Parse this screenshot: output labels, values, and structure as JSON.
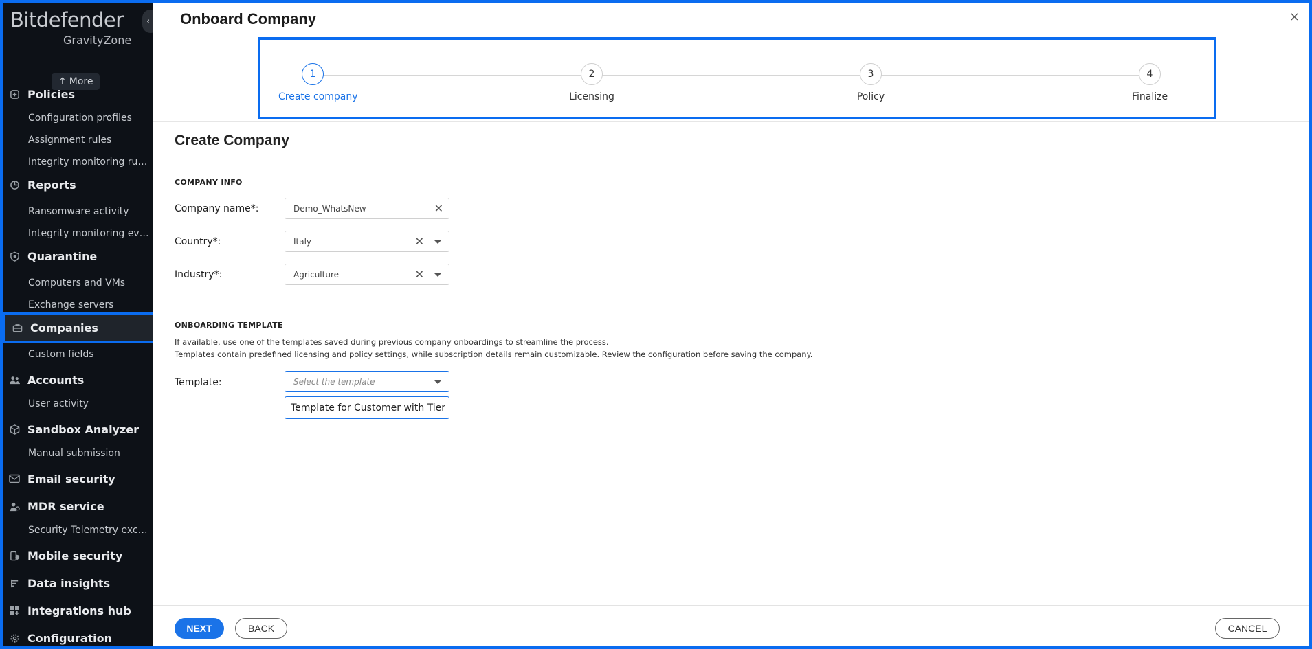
{
  "brand": {
    "name": "Bitdefender",
    "product": "GravityZone"
  },
  "sidebar": {
    "more_label": "More",
    "sections": [
      {
        "label": "Policies",
        "icon": "shield-icon",
        "subs": [
          "Configuration profiles",
          "Assignment rules",
          "Integrity monitoring rules"
        ]
      },
      {
        "label": "Reports",
        "icon": "chart-icon",
        "subs": [
          "Ransomware activity",
          "Integrity monitoring eve..."
        ]
      },
      {
        "label": "Quarantine",
        "icon": "quarantine-icon",
        "subs": [
          "Computers and VMs",
          "Exchange servers"
        ]
      },
      {
        "label": "Companies",
        "icon": "briefcase-icon",
        "subs": [
          "Custom fields"
        ]
      },
      {
        "label": "Accounts",
        "icon": "users-icon",
        "subs": [
          "User activity"
        ]
      },
      {
        "label": "Sandbox Analyzer",
        "icon": "cube-icon",
        "subs": [
          "Manual submission"
        ]
      },
      {
        "label": "Email security",
        "icon": "mail-icon",
        "subs": []
      },
      {
        "label": "MDR service",
        "icon": "mdr-icon",
        "subs": [
          "Security Telemetry excl..."
        ]
      },
      {
        "label": "Mobile security",
        "icon": "mobile-shield-icon",
        "subs": []
      },
      {
        "label": "Data insights",
        "icon": "insights-icon",
        "subs": []
      },
      {
        "label": "Integrations hub",
        "icon": "grid-icon",
        "subs": []
      },
      {
        "label": "Configuration",
        "icon": "gear-icon",
        "subs": []
      }
    ]
  },
  "dialog": {
    "title": "Onboard Company",
    "close_label": "×",
    "steps": [
      {
        "num": "1",
        "label": "Create company"
      },
      {
        "num": "2",
        "label": "Licensing"
      },
      {
        "num": "3",
        "label": "Policy"
      },
      {
        "num": "4",
        "label": "Finalize"
      }
    ],
    "section_title": "Create Company",
    "company_info": {
      "heading": "COMPANY INFO",
      "company_name_label": "Company name*:",
      "company_name_value": "Demo_WhatsNew",
      "country_label": "Country*:",
      "country_value": "Italy",
      "industry_label": "Industry*:",
      "industry_value": "Agriculture"
    },
    "onboarding_template": {
      "heading": "ONBOARDING TEMPLATE",
      "help_line1": "If available, use one of the templates saved during previous company onboardings to streamline the process.",
      "help_line2": "Templates contain predefined licensing and policy settings, while subscription details remain customizable. Review the configuration before saving the company.",
      "template_label": "Template:",
      "template_placeholder": "Select the template",
      "template_option": "Template for Customer with Tier ..."
    },
    "buttons": {
      "next": "NEXT",
      "back": "BACK",
      "cancel": "CANCEL"
    }
  },
  "colors": {
    "accent": "#1a73e8",
    "highlight": "#0a6cf0",
    "sidebar_bg": "#0d1117"
  }
}
